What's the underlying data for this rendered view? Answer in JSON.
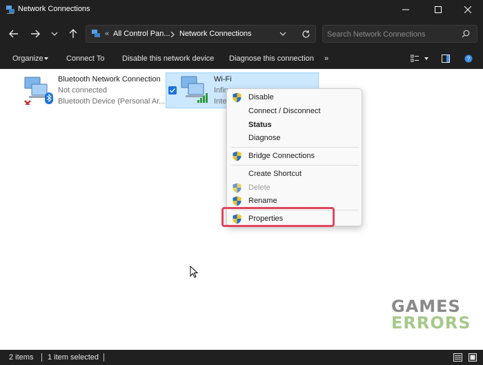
{
  "window": {
    "title": "Network Connections"
  },
  "address": {
    "path_prefix": "«",
    "crumbs": [
      "All Control Pan...",
      "Network Connections"
    ]
  },
  "search": {
    "placeholder": "Search Network Connections"
  },
  "toolbar": {
    "organize": "Organize",
    "connect_to": "Connect To",
    "disable_device": "Disable this network device",
    "diagnose": "Diagnose this connection",
    "more": "»"
  },
  "items": [
    {
      "name": "Bluetooth Network Connection",
      "status": "Not connected",
      "device": "Bluetooth Device (Personal Ar..."
    },
    {
      "name": "Wi-Fi",
      "status": "Infin",
      "device": "Inte"
    }
  ],
  "context_menu": {
    "items": [
      {
        "label": "Disable",
        "shield": true
      },
      {
        "label": "Connect / Disconnect",
        "shield": false
      },
      {
        "label": "Status",
        "shield": false,
        "bold": true
      },
      {
        "label": "Diagnose",
        "shield": false
      },
      {
        "label": "Bridge Connections",
        "shield": true
      },
      {
        "label": "Create Shortcut",
        "shield": false
      },
      {
        "label": "Delete",
        "shield": true,
        "disabled": true
      },
      {
        "label": "Rename",
        "shield": true
      },
      {
        "label": "Properties",
        "shield": true
      }
    ]
  },
  "status_bar": {
    "item_count": "2 items",
    "selected": "1 item selected"
  },
  "watermark": {
    "line1": "GAMES",
    "line2": "ERRORS"
  },
  "colors": {
    "highlight_border": "#e0455c",
    "selection_bg": "#cce8ff",
    "watermark_top": "#8a8a8a",
    "watermark_bottom": "#a6c98a"
  }
}
